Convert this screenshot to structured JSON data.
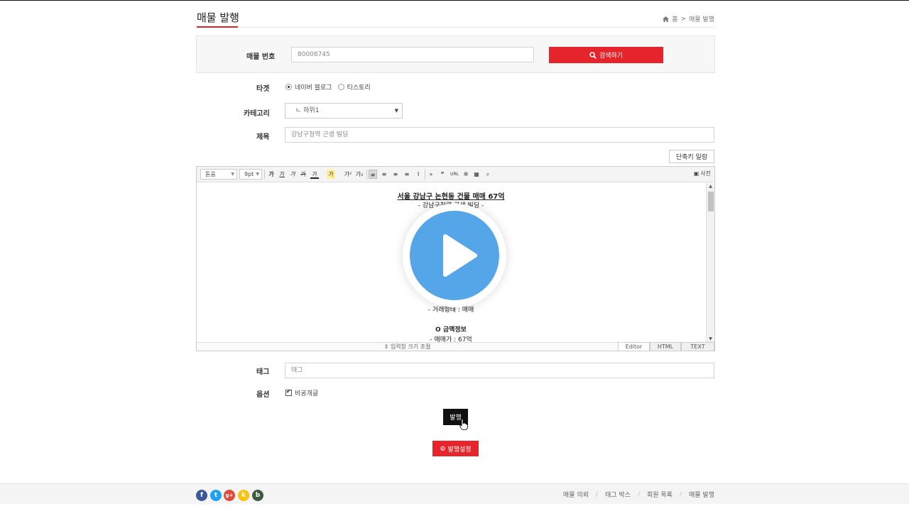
{
  "header": {
    "page_title": "매물 발행",
    "breadcrumb_home": "홈",
    "breadcrumb_sep": ">",
    "breadcrumb_current": "매물 발행"
  },
  "search": {
    "label": "매물 번호",
    "value": "80008745",
    "button_label": "검색하기"
  },
  "target": {
    "label": "타겟",
    "options": [
      {
        "label": "네이버 블로그",
        "checked": true
      },
      {
        "label": "티스토리",
        "checked": false
      }
    ]
  },
  "category": {
    "label": "카테고리",
    "selected": "ㄴ 하위1"
  },
  "title_field": {
    "label": "제목",
    "value": "강남구청역 근생 빌딩"
  },
  "shortcut_button": "단축키 일람",
  "editor": {
    "font_select": "돋움",
    "size_select": "9pt",
    "photo_button": "사진",
    "content": {
      "doc_title": "서울 강남구 논현동 건물 매매 67억",
      "subtitle": "- 강남구청역 근생 빌딩 -",
      "trade_type": "- 거래형태 : 매매",
      "price_section": "O 금액정보",
      "price": "- 매매가 : 67억"
    },
    "resize_label": "입력창 크기 조절",
    "tabs": [
      "Editor",
      "HTML",
      "TEXT"
    ]
  },
  "tags": {
    "label": "태그",
    "placeholder": "태그"
  },
  "options": {
    "label": "옵션",
    "private_label": "비공개글",
    "private_checked": true
  },
  "publish_button": "발행",
  "settings_button": "발행설정",
  "footer": {
    "social": [
      "f",
      "t",
      "g+",
      "k",
      "b"
    ],
    "links": [
      "매물 의뢰",
      "태그 박스",
      "회원 목록",
      "매물 발행"
    ]
  },
  "colors": {
    "accent_red": "#e5252b",
    "play_blue": "#55a6e9"
  }
}
